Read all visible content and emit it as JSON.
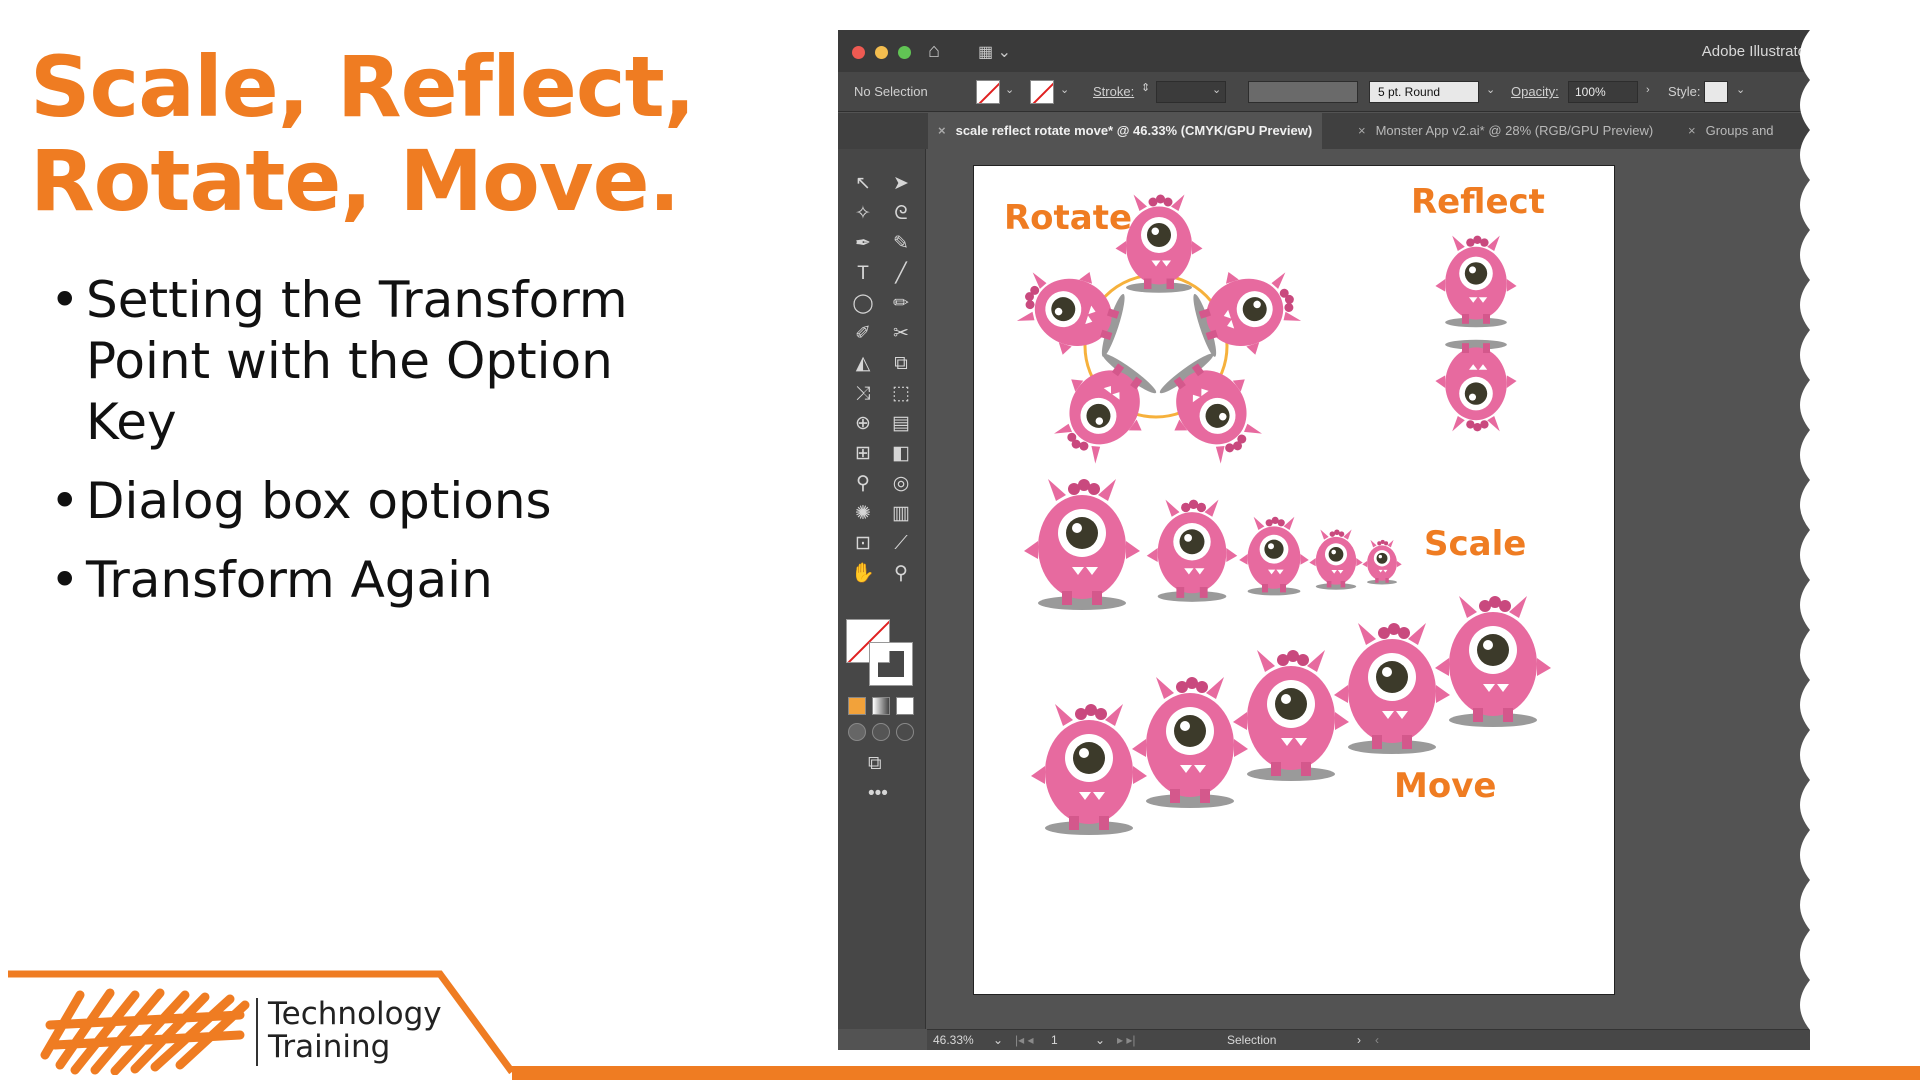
{
  "slide": {
    "title_line1": "Scale, Reflect,",
    "title_line2": "Rotate, Move.",
    "bullets": [
      "Setting the Transform Point with the Option Key",
      "Dialog box options",
      "Transform Again"
    ],
    "footer": {
      "logo_line1": "Technology",
      "logo_line2": "Training"
    },
    "colors": {
      "accent": "#ef7c22",
      "text": "#111111"
    }
  },
  "illustrator": {
    "app_name": "Adobe Illustrato",
    "control_bar": {
      "selection": "No Selection",
      "stroke_label": "Stroke:",
      "brush_value": "5 pt. Round",
      "opacity_label": "Opacity:",
      "opacity_value": "100%",
      "style_label": "Style:"
    },
    "tabs": [
      {
        "label": "scale reflect rotate move* @ 46.33% (CMYK/GPU Preview)",
        "active": true
      },
      {
        "label": "Monster App v2.ai* @ 28% (RGB/GPU Preview)",
        "active": false
      },
      {
        "label": "Groups and",
        "active": false
      }
    ],
    "artboard_labels": {
      "rotate": "Rotate",
      "reflect": "Reflect",
      "scale": "Scale",
      "move": "Move"
    },
    "status_bar": {
      "zoom": "46.33%",
      "artboard_number": "1",
      "tool": "Selection"
    },
    "colors": {
      "monster_pink": "#e76a9f",
      "orange_label": "#ef7c22",
      "ui_dark": "#535353"
    }
  }
}
